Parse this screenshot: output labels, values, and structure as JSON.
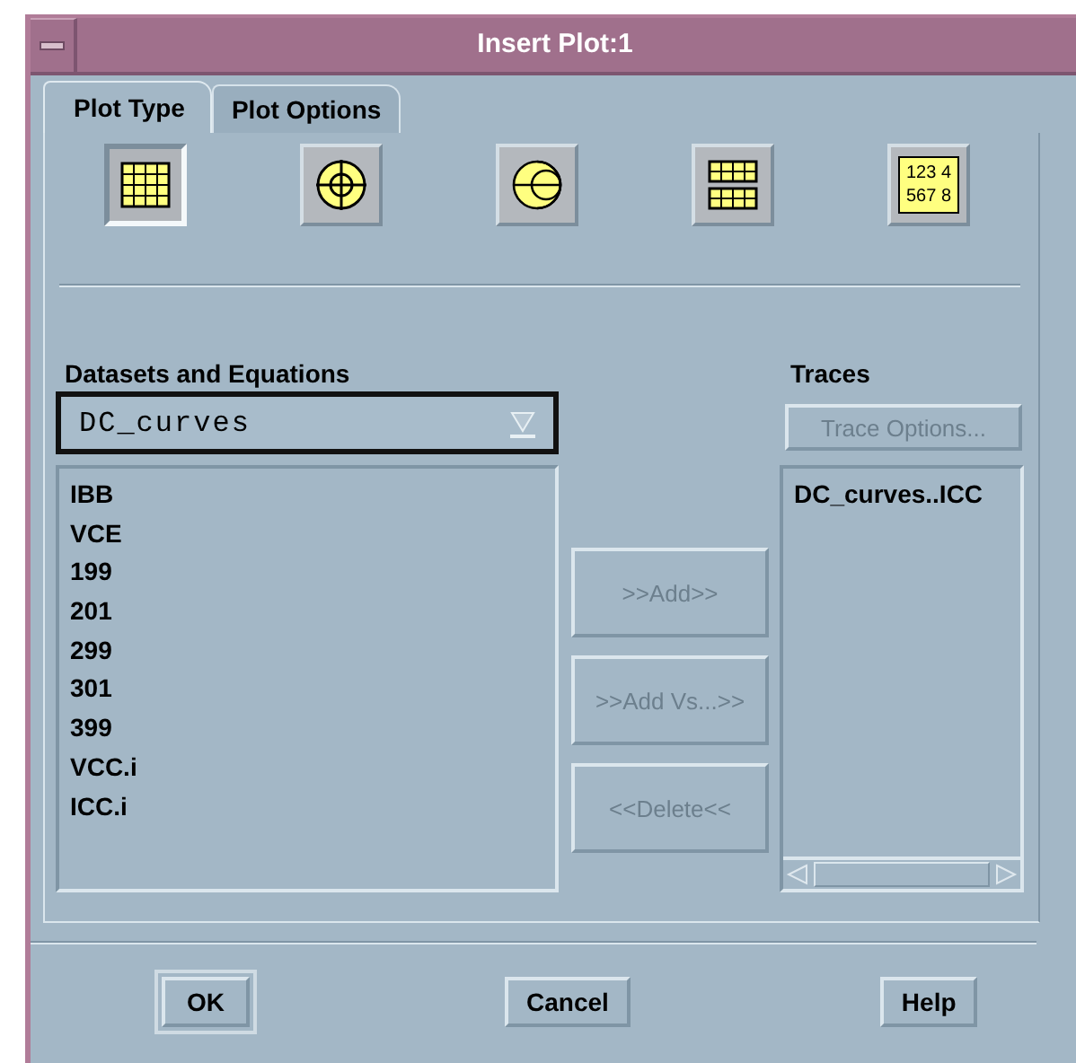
{
  "window": {
    "title": "Insert Plot:1"
  },
  "tabs": [
    {
      "label": "Plot Type",
      "selected": true
    },
    {
      "label": "Plot Options",
      "selected": false
    }
  ],
  "plot_types": [
    {
      "kind": "rectangular",
      "selected": true
    },
    {
      "kind": "polar",
      "selected": false
    },
    {
      "kind": "smith",
      "selected": false
    },
    {
      "kind": "stack",
      "selected": false
    },
    {
      "kind": "list",
      "selected": false,
      "lines": [
        "123 4",
        "567 8"
      ]
    }
  ],
  "datasets": {
    "label": "Datasets and Equations",
    "dropdown": {
      "value": "DC_curves"
    },
    "items": [
      "IBB",
      "VCE",
      "199",
      "201",
      "299",
      "301",
      "399",
      "VCC.i",
      "ICC.i"
    ]
  },
  "actions": [
    {
      "label": ">>Add>>",
      "disabled": true
    },
    {
      "label": ">>Add Vs...>>",
      "disabled": true
    },
    {
      "label": "<<Delete<<",
      "disabled": true
    }
  ],
  "traces": {
    "label": "Traces",
    "options_button": {
      "label": "Trace Options...",
      "disabled": true
    },
    "items": [
      "DC_curves..ICC"
    ]
  },
  "buttons": [
    {
      "label": "OK",
      "default": true
    },
    {
      "label": "Cancel",
      "default": false
    },
    {
      "label": "Help",
      "default": false
    }
  ]
}
